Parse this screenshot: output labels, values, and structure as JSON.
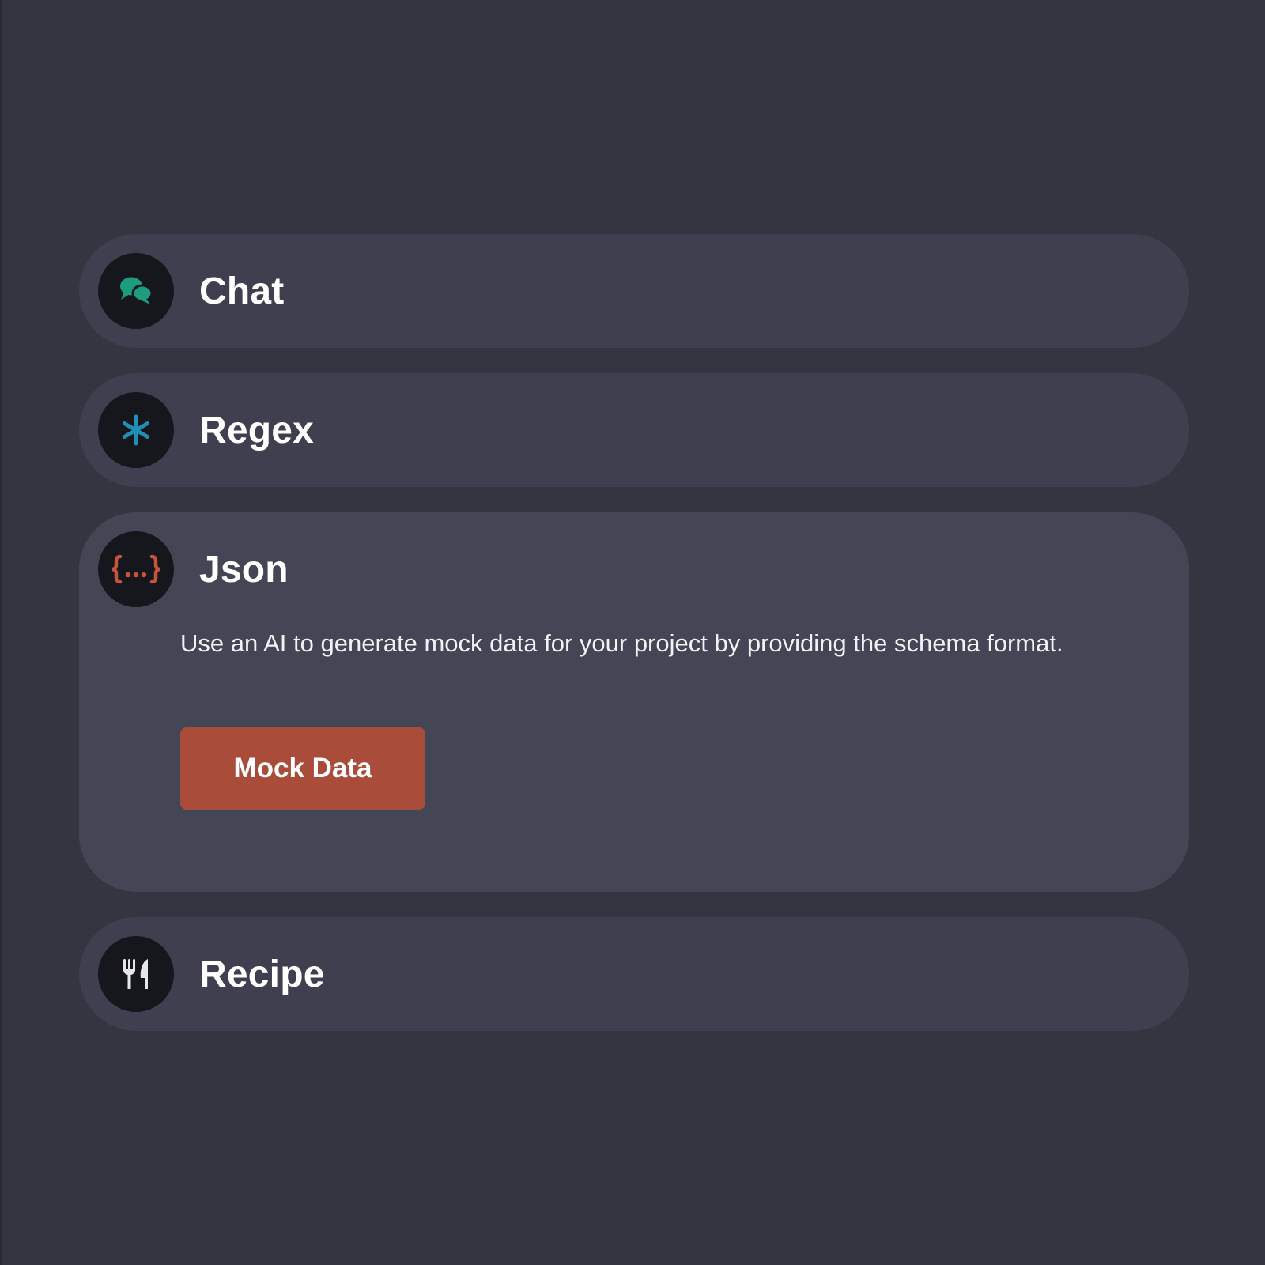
{
  "colors": {
    "page_background": "#353441",
    "card_background": "#3f3f4f",
    "card_background_expanded": "#444555",
    "icon_circle": "#16171c",
    "chat_accent": "#1c9d7e",
    "regex_accent": "#1f8fb4",
    "json_accent": "#c4553b",
    "recipe_accent": "#e6e6ea",
    "button_background": "#a94d3a",
    "text": "#ffffff"
  },
  "tools": [
    {
      "title": "Chat",
      "icon": "chat-bubbles-icon",
      "expanded": false
    },
    {
      "title": "Regex",
      "icon": "asterisk-icon",
      "expanded": false
    },
    {
      "title": "Json",
      "icon": "curly-braces-icon",
      "expanded": true,
      "description": "Use an AI to generate mock data for your project by providing the schema format.",
      "button_label": "Mock Data"
    },
    {
      "title": "Recipe",
      "icon": "fork-knife-icon",
      "expanded": false
    }
  ]
}
